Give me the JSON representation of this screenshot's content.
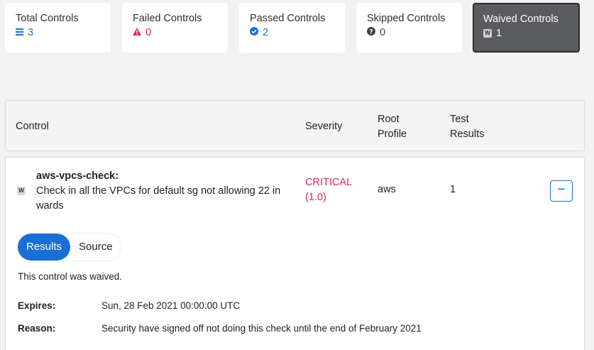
{
  "summary": [
    {
      "title": "Total Controls",
      "count": "3",
      "icon": "list-icon"
    },
    {
      "title": "Failed Controls",
      "count": "0",
      "icon": "warning-icon"
    },
    {
      "title": "Passed Controls",
      "count": "2",
      "icon": "check-circle-icon"
    },
    {
      "title": "Skipped Controls",
      "count": "0",
      "icon": "question-circle-icon"
    },
    {
      "title": "Waived Controls",
      "count": "1",
      "icon": "waived-icon",
      "badge": "W"
    }
  ],
  "table": {
    "headers": {
      "control": "Control",
      "severity": "Severity",
      "root_profile": "Root Profile",
      "root_profile_l1": "Root",
      "root_profile_l2": "Profile",
      "test_results_l1": "Test",
      "test_results_l2": "Results"
    },
    "row": {
      "badge": "W",
      "name": "aws-vpcs-check:",
      "desc_l1": "Check in all the VPCs for default sg not allowing 22 in",
      "desc_l2": "wards",
      "severity_l1": "CRITICAL",
      "severity_l2": "(1.0)",
      "root_profile": "aws",
      "test_results": "1",
      "toggle": "−"
    }
  },
  "detail": {
    "tabs": {
      "results": "Results",
      "source": "Source"
    },
    "message": "This control was waived.",
    "expires_label": "Expires:",
    "expires_value": "Sun, 28 Feb 2021 00:00:00 UTC",
    "reason_label": "Reason:",
    "reason_value": "Security have signed off not doing this check until the end of February 2021"
  },
  "colors": {
    "accent": "#1a6fd6",
    "critical": "#e0245e",
    "active_card": "#5a5b5e"
  }
}
